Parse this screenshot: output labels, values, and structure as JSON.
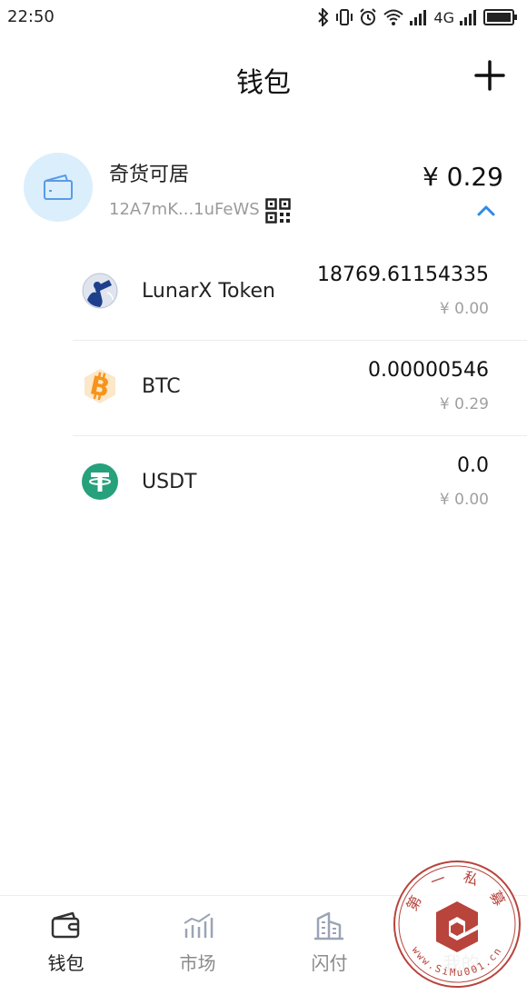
{
  "status_bar": {
    "time": "22:50",
    "network": "4G"
  },
  "header": {
    "title": "钱包",
    "add_icon": "plus-icon"
  },
  "wallet": {
    "name": "奇货可居",
    "address": "12A7mK...1uFeWS",
    "balance": "¥ 0.29",
    "avatar_icon": "wallet-icon",
    "accent_color": "#2e8ae6",
    "avatar_bg": "#dbeefc"
  },
  "tokens": [
    {
      "name": "LunarX Token",
      "amount": "18769.61154335",
      "value": "¥ 0.00",
      "icon": "lunarx-telescope-icon"
    },
    {
      "name": "BTC",
      "amount": "0.00000546",
      "value": "¥ 0.29",
      "icon": "bitcoin-icon",
      "color": "#f7931a"
    },
    {
      "name": "USDT",
      "amount": "0.0",
      "value": "¥ 0.00",
      "icon": "tether-icon",
      "color": "#26a17b"
    }
  ],
  "tab_bar": {
    "tabs": [
      {
        "label": "钱包",
        "icon": "wallet-icon",
        "active": true
      },
      {
        "label": "市场",
        "icon": "chart-icon",
        "active": false
      },
      {
        "label": "闪付",
        "icon": "building-icon",
        "active": false
      },
      {
        "label": "我的",
        "icon": "profile-icon",
        "active": false
      }
    ]
  },
  "watermark": {
    "text_top": "第 一 私 募",
    "text_bottom": "www.SiMu001.cn",
    "color": "#b8443c"
  }
}
